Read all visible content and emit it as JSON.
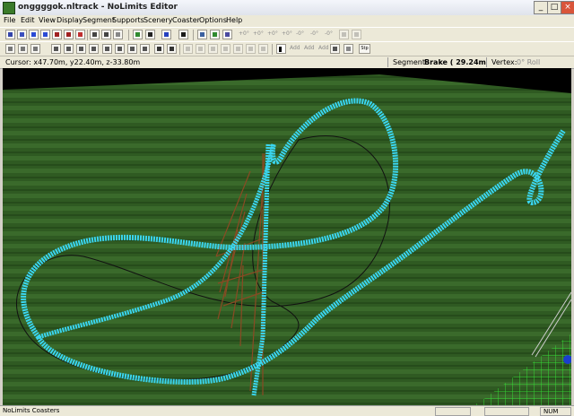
{
  "window": {
    "title": "onggggok.nltrack - NoLimits Editor",
    "buttons": {
      "minimize": "_",
      "maximize": "□",
      "close": "×"
    }
  },
  "menu": [
    "File",
    "Edit",
    "View",
    "Display",
    "Segment",
    "Supports",
    "Scenery",
    "Coaster",
    "Options",
    "Help"
  ],
  "toolbar": {
    "row1_text_tools": [
      "+0°",
      "+0°",
      "+0°",
      "+0°",
      "-0°",
      "-0°",
      "-0°"
    ],
    "row2_text_tools": [
      "Add",
      "Add",
      "Add"
    ],
    "stop_label": "Stp"
  },
  "info": {
    "cursor": "Cursor: x47.70m, y22.40m, z-33.80m",
    "segment_label": "Segment:",
    "segment_value": "Brake ( 29.24m",
    "vertex_label": "Vertex:",
    "vertex_value": "0° Roll"
  },
  "status": {
    "text": "NoLimits Coasters",
    "indicator": "NUM"
  },
  "colors": {
    "track": "#3ad6f0",
    "grass": "#2f5a22",
    "supports": "#8a4a24",
    "station_grid": "#37e838"
  }
}
